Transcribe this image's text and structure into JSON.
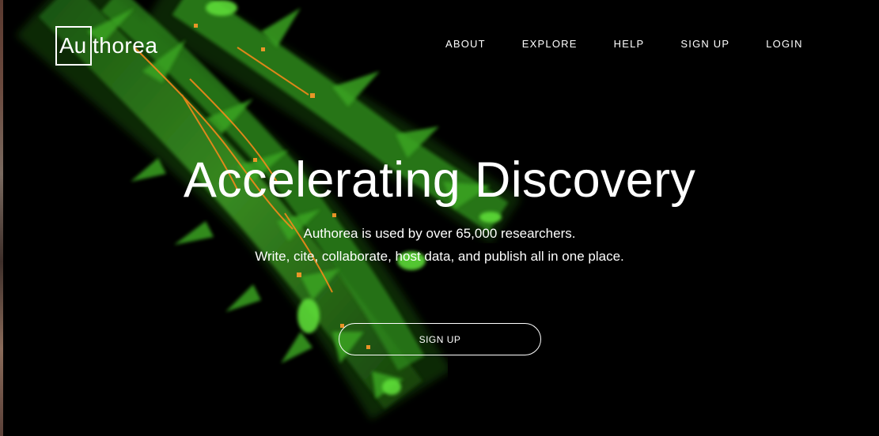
{
  "logo": {
    "boxed": "Au",
    "rest": "thorea"
  },
  "nav": {
    "about": "ABOUT",
    "explore": "EXPLORE",
    "help": "HELP",
    "signup": "SIGN UP",
    "login": "LOGIN"
  },
  "hero": {
    "headline": "Accelerating Discovery",
    "line1": "Authorea is used by over 65,000 researchers.",
    "line2": "Write, cite, collaborate, host data, and publish all in one place.",
    "cta": "SIGN UP"
  },
  "colors": {
    "background": "#000000",
    "text": "#ffffff",
    "image_green": "#3fae2a",
    "image_orange": "#ff8a1a"
  }
}
